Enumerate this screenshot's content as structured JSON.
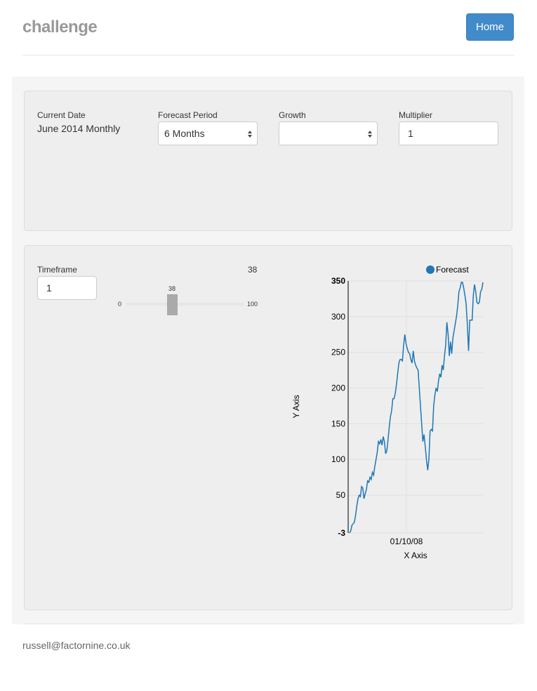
{
  "header": {
    "brand": "challenge",
    "home_label": "Home"
  },
  "settings": {
    "current_date_label": "Current Date",
    "current_date_value": "June 2014 Monthly",
    "forecast_period_label": "Forecast Period",
    "forecast_period_value": "6 Months",
    "growth_label": "Growth",
    "growth_value": "",
    "multiplier_label": "Multiplier",
    "multiplier_value": "1"
  },
  "timeframe": {
    "label": "Timeframe",
    "input_value": "1",
    "display_value": "38",
    "slider_value": "38",
    "slider_min": "0",
    "slider_max": "100"
  },
  "chart_data": {
    "type": "line",
    "xlabel": "X Axis",
    "ylabel": "Y Axis",
    "ylim": [
      -3,
      350
    ],
    "y_ticks": [
      "-3",
      "50",
      "100",
      "150",
      "200",
      "250",
      "300",
      "350"
    ],
    "x_ticks": [
      "01/10/08"
    ],
    "legend": "top-right",
    "grid": true,
    "series": [
      {
        "name": "Forecast",
        "color": "#1f77b4",
        "values": [
          -3,
          0,
          8,
          10,
          12,
          22,
          35,
          45,
          50,
          48,
          62,
          60,
          45,
          52,
          58,
          70,
          68,
          75,
          72,
          82,
          78,
          90,
          100,
          110,
          125,
          122,
          128,
          120,
          132,
          125,
          108,
          112,
          128,
          145,
          160,
          168,
          185,
          185,
          192,
          205,
          220,
          235,
          240,
          240,
          238,
          260,
          275,
          262,
          255,
          250,
          248,
          240,
          235,
          252,
          238,
          232,
          228,
          225,
          200,
          175,
          150,
          125,
          135,
          118,
          100,
          85,
          100,
          140,
          142,
          140,
          175,
          190,
          200,
          195,
          210,
          220,
          215,
          232,
          225,
          245,
          260,
          292,
          275,
          245,
          265,
          248,
          270,
          280,
          290,
          300,
          315,
          335,
          340,
          348,
          348,
          340,
          330,
          318,
          290,
          252,
          295,
          295,
          295,
          330,
          345,
          335,
          320,
          318,
          320,
          335,
          338,
          348
        ]
      }
    ]
  },
  "footer": {
    "email": "russell@factornine.co.uk"
  }
}
